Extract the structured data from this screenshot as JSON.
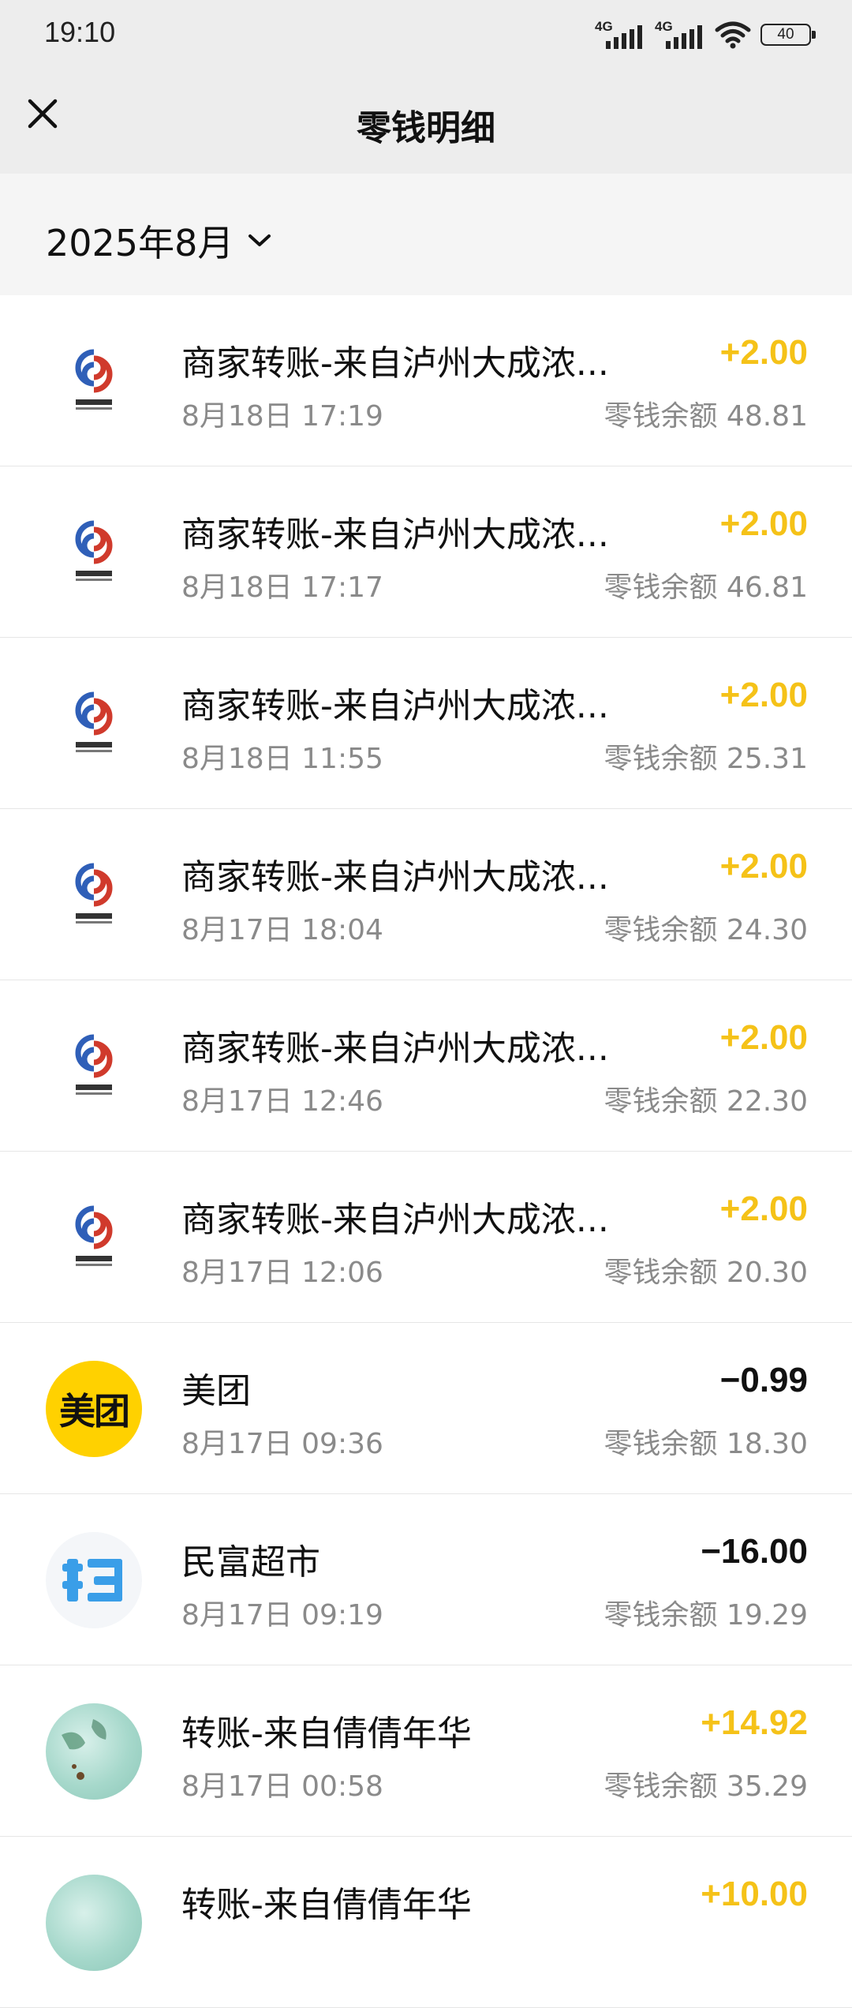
{
  "status_bar": {
    "time": "19:10",
    "net1": "4G",
    "net2": "4G",
    "battery": "40"
  },
  "header": {
    "title": "零钱明细"
  },
  "filter": {
    "month": "2025年8月"
  },
  "colors": {
    "income": "#f5c218",
    "expense": "#111111",
    "meituan_brand": "#ffd100",
    "scan_blue": "#3a9ee8"
  },
  "transactions": [
    {
      "avatar": "merchant-logo",
      "name": "商家转账-来自泸州大成浓...",
      "date": "8月18日 17:19",
      "amount": "+2.00",
      "balance": "零钱余额 48.81"
    },
    {
      "avatar": "merchant-logo",
      "name": "商家转账-来自泸州大成浓...",
      "date": "8月18日 17:17",
      "amount": "+2.00",
      "balance": "零钱余额 46.81"
    },
    {
      "avatar": "merchant-logo",
      "name": "商家转账-来自泸州大成浓...",
      "date": "8月18日 11:55",
      "amount": "+2.00",
      "balance": "零钱余额 25.31"
    },
    {
      "avatar": "merchant-logo",
      "name": "商家转账-来自泸州大成浓...",
      "date": "8月17日 18:04",
      "amount": "+2.00",
      "balance": "零钱余额 24.30"
    },
    {
      "avatar": "merchant-logo",
      "name": "商家转账-来自泸州大成浓...",
      "date": "8月17日 12:46",
      "amount": "+2.00",
      "balance": "零钱余额 22.30"
    },
    {
      "avatar": "merchant-logo",
      "name": "商家转账-来自泸州大成浓...",
      "date": "8月17日 12:06",
      "amount": "+2.00",
      "balance": "零钱余额 20.30"
    },
    {
      "avatar": "meituan-logo",
      "avatar_text": "美团",
      "name": "美团",
      "date": "8月17日 09:36",
      "amount": "−0.99",
      "balance": "零钱余额 18.30"
    },
    {
      "avatar": "scan-icon",
      "avatar_text": "扫",
      "name": "民富超市",
      "date": "8月17日 09:19",
      "amount": "−16.00",
      "balance": "零钱余额 19.29"
    },
    {
      "avatar": "user-photo",
      "name": "转账-来自倩倩年华",
      "date": "8月17日 00:58",
      "amount": "+14.92",
      "balance": "零钱余额 35.29"
    },
    {
      "avatar": "user-photo",
      "name": "转账-来自倩倩年华",
      "date": "",
      "amount": "+10.00",
      "balance": ""
    }
  ]
}
